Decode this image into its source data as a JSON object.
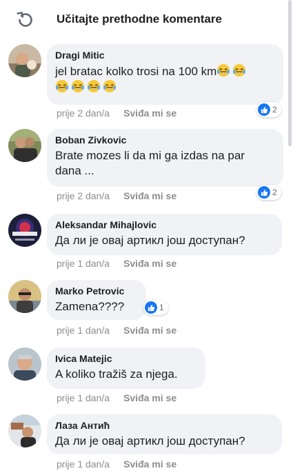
{
  "header": {
    "title": "Učitajte prethodne komentare",
    "icon": "refresh-icon"
  },
  "comments": [
    {
      "author": "Dragi Mitic",
      "text": "jel bratac kolko trosi na 100 km",
      "emojis": 6,
      "emoji_icon": "laughing-tears-emoji",
      "time": "prije 2 dan/a",
      "like_label": "Sviđa mi se",
      "reaction_count": "2"
    },
    {
      "author": "Boban Zivkovic",
      "text_line1": "Brate mozes li da mi ga izdas na par",
      "text_line2": "dana ...",
      "time": "prije 2 dan/a",
      "like_label": "Sviđa mi se",
      "reaction_count": "2"
    },
    {
      "author": "Aleksandar Mihajlovic",
      "text": "Да ли је овај артикл још доступан?",
      "time": "prije 1 dan/a",
      "like_label": "Sviđa mi se"
    },
    {
      "author": "Marko Petrovic",
      "text": "Zamena????",
      "time": "prije 1 dan/a",
      "like_label": "Sviđa mi se",
      "reaction_count": "1"
    },
    {
      "author": "Ivica Matejic",
      "text": "A koliko tražiš za njega.",
      "time": "prije 1 dan/a",
      "like_label": "Sviđa mi se"
    },
    {
      "author": "Лаза Антић",
      "text": "Да ли је овај артикл још доступан?",
      "time": "prije 1 dan/a",
      "like_label": "Sviđa mi se"
    }
  ],
  "colors": {
    "bubble": "#f0f2f5",
    "like_blue": "#1877f2",
    "meta_gray": "#8a8d91"
  }
}
